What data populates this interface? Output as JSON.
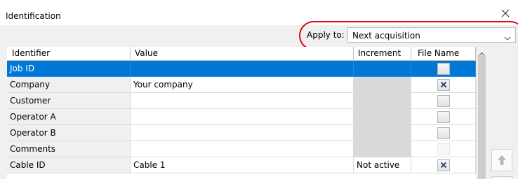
{
  "window": {
    "title": "Identification"
  },
  "apply_to": {
    "label": "Apply to:",
    "selected": "Next acquisition"
  },
  "colors": {
    "selection": "#0078d7",
    "highlight_ring": "#e30613",
    "disabled_cell": "#dadada"
  },
  "table": {
    "columns": [
      "Identifier",
      "Value",
      "Increment",
      "File Name"
    ],
    "rows": [
      {
        "identifier": "Job ID",
        "value": "",
        "increment": "",
        "file_name_checked": false,
        "file_name_enabled": true,
        "increment_disabled": false,
        "selected": true
      },
      {
        "identifier": "Company",
        "value": "Your company",
        "increment": "",
        "file_name_checked": true,
        "file_name_enabled": true,
        "increment_disabled": true,
        "selected": false
      },
      {
        "identifier": "Customer",
        "value": "",
        "increment": "",
        "file_name_checked": false,
        "file_name_enabled": true,
        "increment_disabled": true,
        "selected": false
      },
      {
        "identifier": "Operator A",
        "value": "",
        "increment": "",
        "file_name_checked": false,
        "file_name_enabled": true,
        "increment_disabled": true,
        "selected": false
      },
      {
        "identifier": "Operator B",
        "value": "",
        "increment": "",
        "file_name_checked": false,
        "file_name_enabled": true,
        "increment_disabled": true,
        "selected": false
      },
      {
        "identifier": "Comments",
        "value": "",
        "increment": "",
        "file_name_checked": false,
        "file_name_enabled": false,
        "increment_disabled": true,
        "selected": false
      },
      {
        "identifier": "Cable ID",
        "value": "Cable 1",
        "increment": "Not active",
        "file_name_checked": true,
        "file_name_enabled": true,
        "increment_disabled": false,
        "selected": false
      }
    ]
  },
  "icons": {
    "close": "close-icon",
    "dropdown": "chevron-down-icon",
    "move_up": "arrow-up-icon",
    "checkbox_mark": "x-mark-icon"
  }
}
